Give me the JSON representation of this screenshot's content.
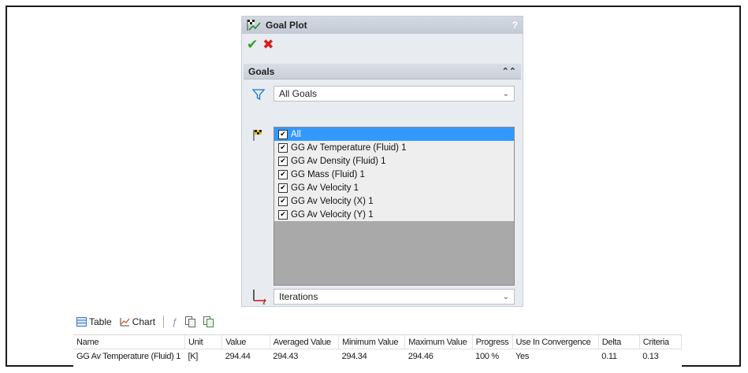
{
  "panel": {
    "title": "Goal Plot",
    "help": "?",
    "ok_icon": "check-icon",
    "cancel_icon": "x-icon"
  },
  "goals_group": {
    "heading": "Goals",
    "filter_value": "All Goals",
    "items": [
      {
        "label": "All",
        "checked": true,
        "selected": true
      },
      {
        "label": "GG Av Temperature (Fluid) 1",
        "checked": true
      },
      {
        "label": "GG Av Density (Fluid) 1",
        "checked": true
      },
      {
        "label": "GG Mass (Fluid) 1",
        "checked": true
      },
      {
        "label": "GG Av Velocity 1",
        "checked": true
      },
      {
        "label": "GG Av Velocity (X) 1",
        "checked": true
      },
      {
        "label": "GG Av Velocity (Y) 1",
        "checked": true
      }
    ],
    "x_axis_value": "Iterations"
  },
  "toolbar": {
    "table_label": "Table",
    "chart_label": "Chart"
  },
  "table": {
    "columns": [
      "Name",
      "Unit",
      "Value",
      "Averaged Value",
      "Minimum Value",
      "Maximum Value",
      "Progress",
      "Use In Convergence",
      "Delta",
      "Criteria"
    ],
    "rows": [
      [
        "GG Av Temperature (Fluid) 1",
        "[K]",
        "294.44",
        "294.43",
        "294.34",
        "294.46",
        "100 %",
        "Yes",
        "0.11",
        "0.13"
      ]
    ]
  }
}
